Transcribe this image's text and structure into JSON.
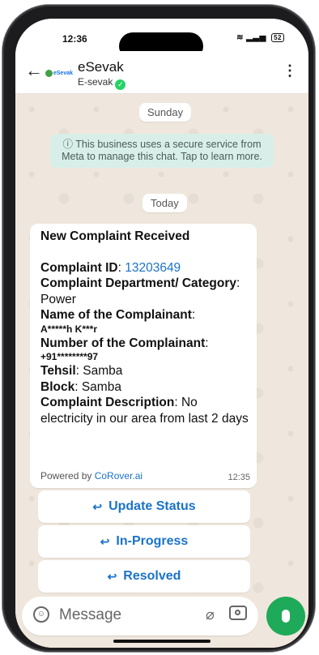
{
  "status_bar": {
    "time": "12:36",
    "battery": "52"
  },
  "header": {
    "title": "eSevak",
    "subtitle": "E-sevak",
    "logo_text": "eSevak"
  },
  "chat": {
    "date_sunday": "Sunday",
    "notice": "ⓘ This business uses a secure service from Meta to manage this chat. Tap to learn more.",
    "date_today": "Today",
    "message": {
      "heading": "New Complaint Received",
      "complaint_id_label": "Complaint ID",
      "complaint_id_value": "13203649",
      "department_label": "Complaint Department/ Category",
      "department_value": "Power",
      "name_label": "Name of the Complainant",
      "name_value": "A*****h K***r",
      "number_label": "Number of the Complainant",
      "number_value": "+91********97",
      "tehsil_label": "Tehsil",
      "tehsil_value": "Samba",
      "block_label": "Block",
      "block_value": "Samba",
      "description_label": "Complaint Description",
      "description_value": "No electricity in our area from last 2 days",
      "powered_by": "Powered by",
      "powered_link": "CoRover.ai",
      "time": "12:35"
    },
    "actions": [
      "Update Status",
      "In-Progress",
      "Resolved"
    ]
  },
  "input": {
    "placeholder": "Message"
  },
  "colors": {
    "accent": "#1faa59",
    "link": "#1a73c9",
    "notice_bg": "#d8efe9"
  }
}
